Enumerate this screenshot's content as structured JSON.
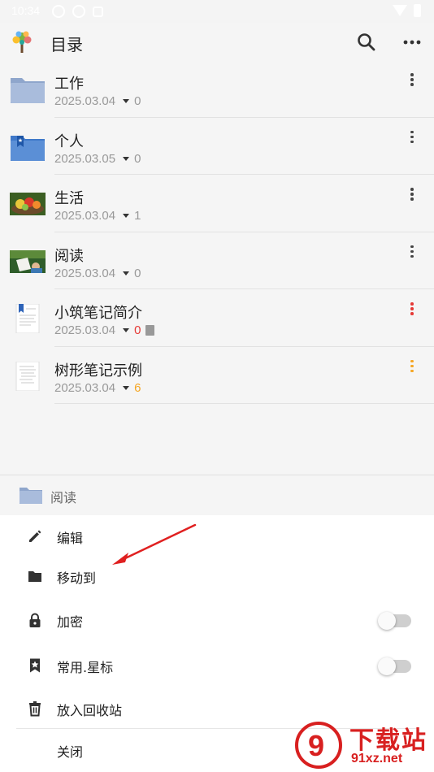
{
  "status_bar": {
    "time": "10:34"
  },
  "app_bar": {
    "title": "目录",
    "icons": [
      "tree-logo-icon",
      "search-icon",
      "more-horizontal-icon"
    ]
  },
  "items": [
    {
      "name": "工作",
      "date": "2025.03.04",
      "count": "0",
      "thumb": "folder-icon",
      "count_color": "#999999"
    },
    {
      "name": "个人",
      "date": "2025.03.05",
      "count": "0",
      "thumb": "bookmark-folder-icon",
      "count_color": "#999999"
    },
    {
      "name": "生活",
      "date": "2025.03.04",
      "count": "1",
      "thumb": "fruit-photo",
      "count_color": "#999999"
    },
    {
      "name": "阅读",
      "date": "2025.03.04",
      "count": "0",
      "thumb": "reading-photo",
      "count_color": "#999999"
    },
    {
      "name": "小筑笔记简介",
      "date": "2025.03.04",
      "count": "0",
      "thumb": "bookmarked-note-icon",
      "count_color": "#e53935",
      "has_doc_icon": true
    },
    {
      "name": "树形笔记示例",
      "date": "2025.03.04",
      "count": "6",
      "thumb": "note-icon",
      "count_color": "#f5a623"
    }
  ],
  "selected_folder": {
    "label": "阅读"
  },
  "menu": {
    "edit": "编辑",
    "move_to": "移动到",
    "encrypt": "加密",
    "encrypt_on": false,
    "favorite": "常用.星标",
    "favorite_on": false,
    "recycle": "放入回收站",
    "close": "关闭"
  },
  "watermark": {
    "big": "下载站",
    "small": "91xz.net",
    "badge": "9"
  },
  "colors": {
    "accent_red": "#e53935",
    "accent_orange": "#f5a623",
    "folder_blue": "#9fb4d8"
  }
}
